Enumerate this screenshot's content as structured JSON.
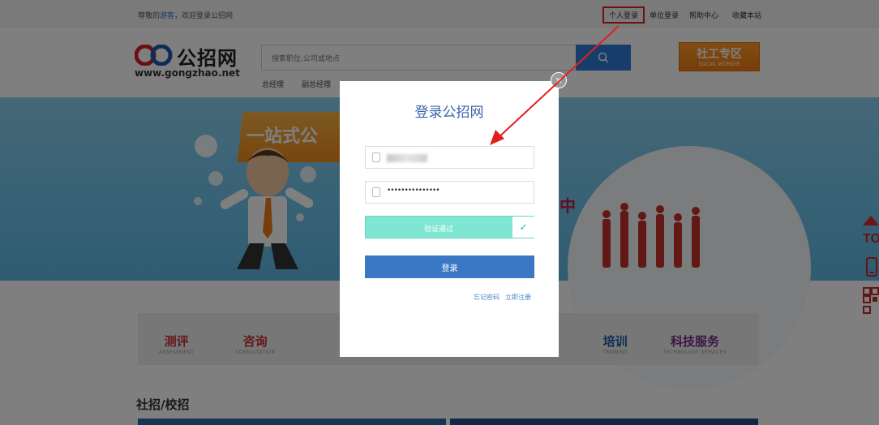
{
  "topbar": {
    "greeting_prefix": "尊敬的",
    "greeting_name": "游客",
    "greeting_suffix": "，欢迎登录公招网",
    "links": {
      "personal_login": "个人登录",
      "company_login": "单位登录",
      "help": "帮助中心",
      "bookmark": "收藏本站"
    }
  },
  "header": {
    "logo_cn": "公招网",
    "logo_url": "www.gongzhao.net",
    "search": {
      "placeholder": "搜索职位,公司或地点"
    },
    "hot_keywords": [
      "总经理",
      "副总经理"
    ],
    "social_worker_badge": {
      "cn": "社工专区",
      "en": "SOCIAL WORKER"
    }
  },
  "banner": {
    "headline": "一站式公",
    "side_text": "中"
  },
  "services": [
    {
      "cn": "测评",
      "en": "ASSESSMENT",
      "color": "#c8323c"
    },
    {
      "cn": "咨询",
      "en": "CONSULTATION",
      "color": "#c8323c"
    },
    {
      "cn": "培训",
      "en": "TRAINING",
      "color": "#1f5aa8"
    },
    {
      "cn": "科技服务",
      "en": "TECHNOLOGY SERVICES",
      "color": "#7a2e8a"
    }
  ],
  "section": {
    "title": "社招/校招"
  },
  "login_modal": {
    "title": "登录公招网",
    "password_mask": "•••••••••••••••",
    "verify_label": "验证通过",
    "verify_check": "✓",
    "submit_label": "登录",
    "forgot_password": "忘记密码",
    "register_now": "立即注册",
    "close_glyph": "✕"
  },
  "icons": {
    "search": "search-icon",
    "close": "close-icon",
    "user": "user-icon",
    "lock": "lock-icon",
    "check": "check-icon",
    "back_to_top": "back-to-top-icon",
    "phone": "phone-icon",
    "qr": "qr-code-icon"
  },
  "colors": {
    "accent_blue": "#3a78c6",
    "annotation_red": "#e02020",
    "verify_green": "#7ee6d3"
  }
}
